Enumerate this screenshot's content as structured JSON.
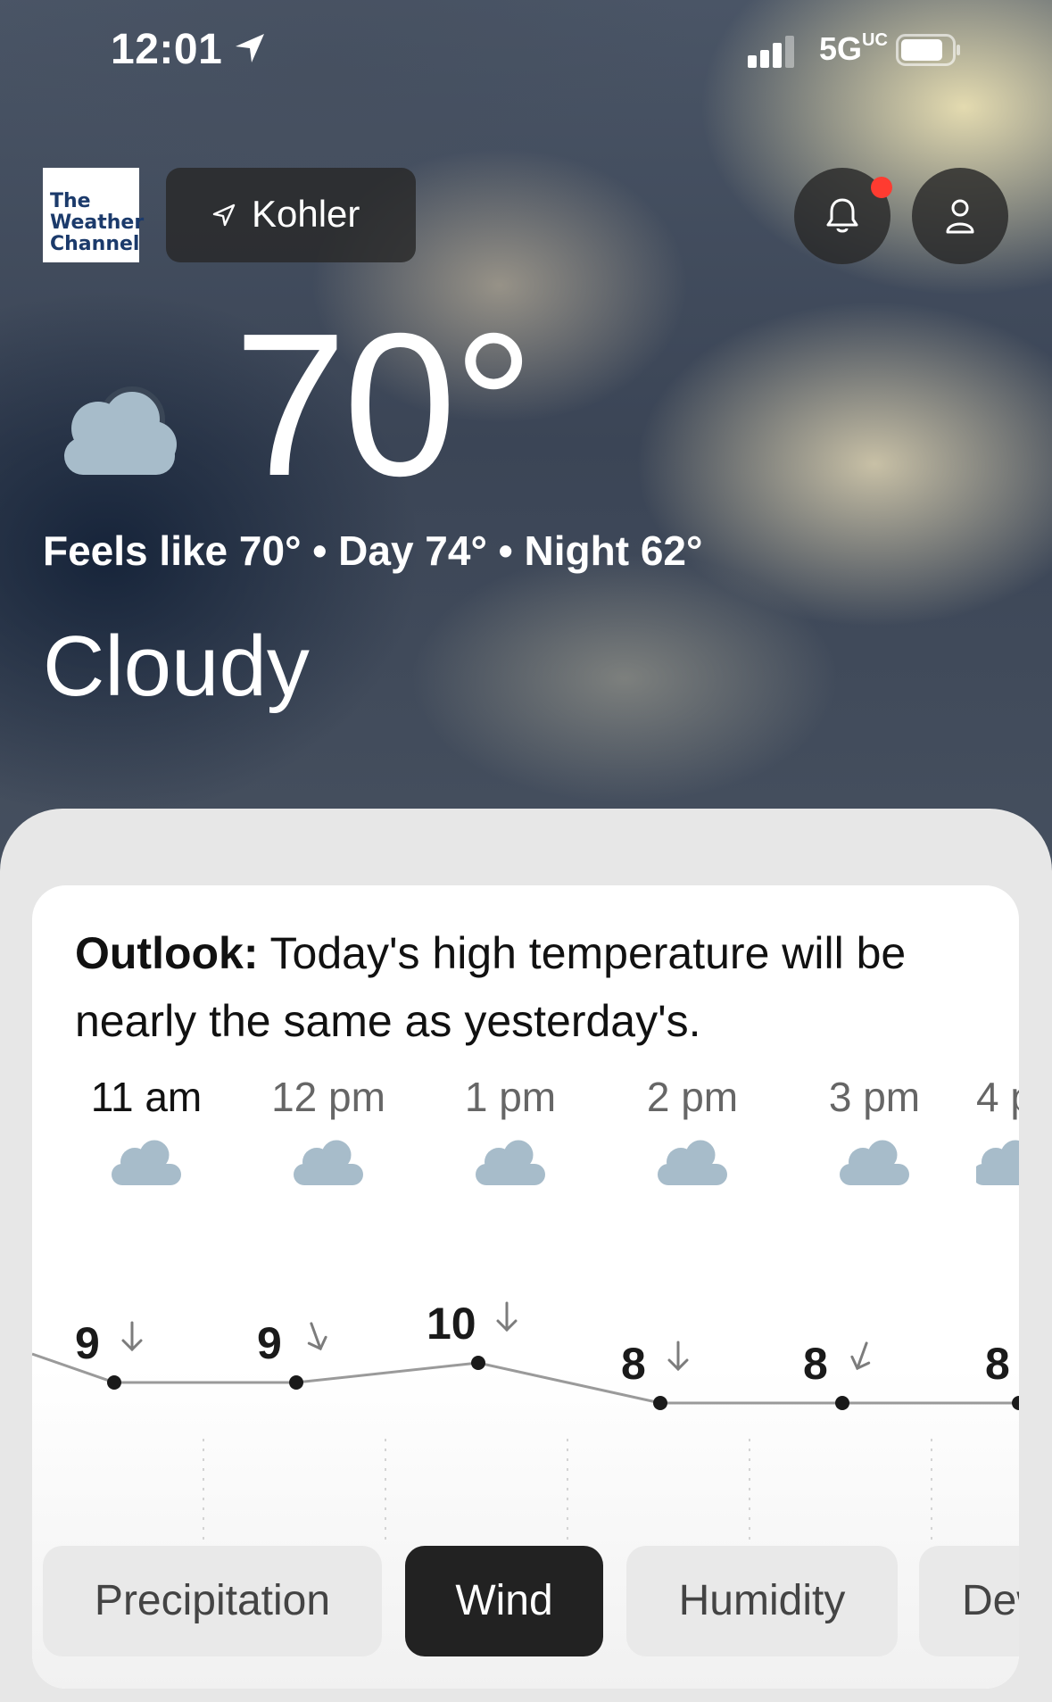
{
  "status_bar": {
    "time": "12:01",
    "network": "5G",
    "network_sup": "UC"
  },
  "brand": {
    "line1": "The",
    "line2": "Weather",
    "line3": "Channel"
  },
  "location": {
    "name": "Kohler",
    "icon": "location-arrow-icon"
  },
  "header_buttons": {
    "notifications_icon": "bell-icon",
    "profile_icon": "person-icon",
    "badge_color": "#ff3b30"
  },
  "current": {
    "temperature": "70°",
    "summary": "Feels like 70° • Day 74° • Night 62°",
    "condition": "Cloudy",
    "icon": "cloud-icon"
  },
  "outlook": {
    "label": "Outlook:",
    "text": " Today's high temperature will be nearly the same as yesterday's."
  },
  "hourly": [
    {
      "time": "11 am",
      "wind": "9",
      "icon": "cloud-icon"
    },
    {
      "time": "12 pm",
      "wind": "9",
      "icon": "cloud-icon"
    },
    {
      "time": "1 pm",
      "wind": "10",
      "icon": "cloud-icon"
    },
    {
      "time": "2 pm",
      "wind": "8",
      "icon": "cloud-icon"
    },
    {
      "time": "3 pm",
      "wind": "8",
      "icon": "cloud-icon"
    },
    {
      "time": "4 p",
      "wind": "8",
      "icon": "cloud-icon"
    }
  ],
  "tabs": [
    {
      "label": "Precipitation",
      "active": false
    },
    {
      "label": "Wind",
      "active": true
    },
    {
      "label": "Humidity",
      "active": false
    },
    {
      "label": "Dew",
      "active": false
    }
  ],
  "colors": {
    "cloud": "#a7bcca",
    "active_tab": "#222222"
  }
}
